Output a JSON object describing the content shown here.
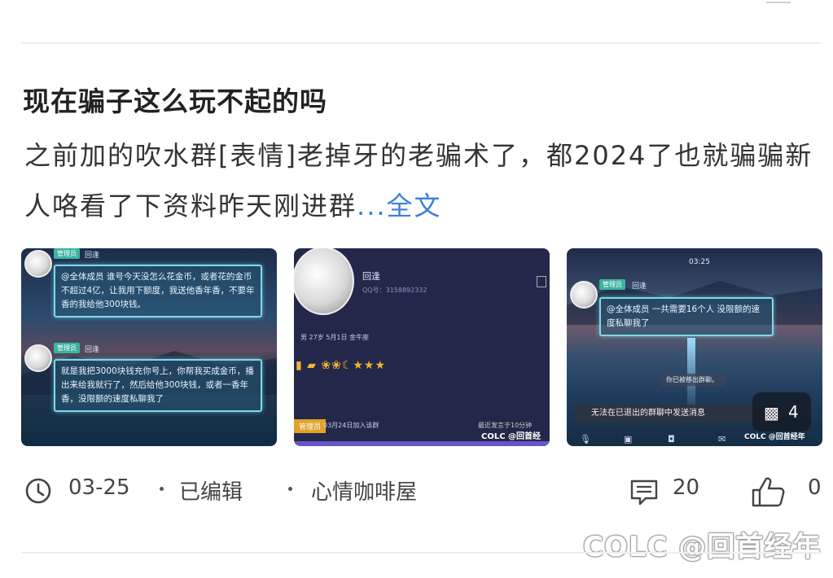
{
  "post": {
    "title": "现在骗子这么玩不起的吗",
    "body_text": " 之前加的吹水群[表情]老掉牙的老骗术了，都2024了也就骗骗新人咯看了下资料昨天刚进群",
    "more_label": "...全文"
  },
  "images": {
    "count": "4",
    "img1": {
      "tag1": "管理员",
      "name1": "回逢",
      "msg1": "@全体成员 谁号今天没怎么花金币，或者花的金币不超过4亿，让我用下额度，我送他香年香，不要年香的我给他300块钱。",
      "tag2": "管理员",
      "name2": "回逢",
      "msg2": "就是我把3000块钱充你号上，你帮我买成金币，播出来给我就行了，然后给他300块钱，或者一香年香，没限额的速度私聊我了"
    },
    "img2": {
      "name": "回逢",
      "qq": "QQ号：3158892332",
      "info": "男  27岁  5月1日  金牛座",
      "role": "管理员",
      "join": "03月24日加入该群",
      "watermark_small": "最近发言于10分钟",
      "watermark_brand": "COLC @回首经"
    },
    "img3": {
      "time": "03:25",
      "tag": "管理员",
      "name": "回逢",
      "msg": "@全体成员 一共需要16个人 没限额的速度私聊我了",
      "system": "你已被移出群聊。",
      "warning": "无法在已退出的群聊中发送消息",
      "watermark_brand": "COLC @回首经年"
    }
  },
  "meta": {
    "date": "03-25",
    "edited": "已编辑",
    "board": "心情咖啡屋",
    "comments": "20",
    "likes": "0"
  },
  "watermark": "COLC @回首经年"
}
